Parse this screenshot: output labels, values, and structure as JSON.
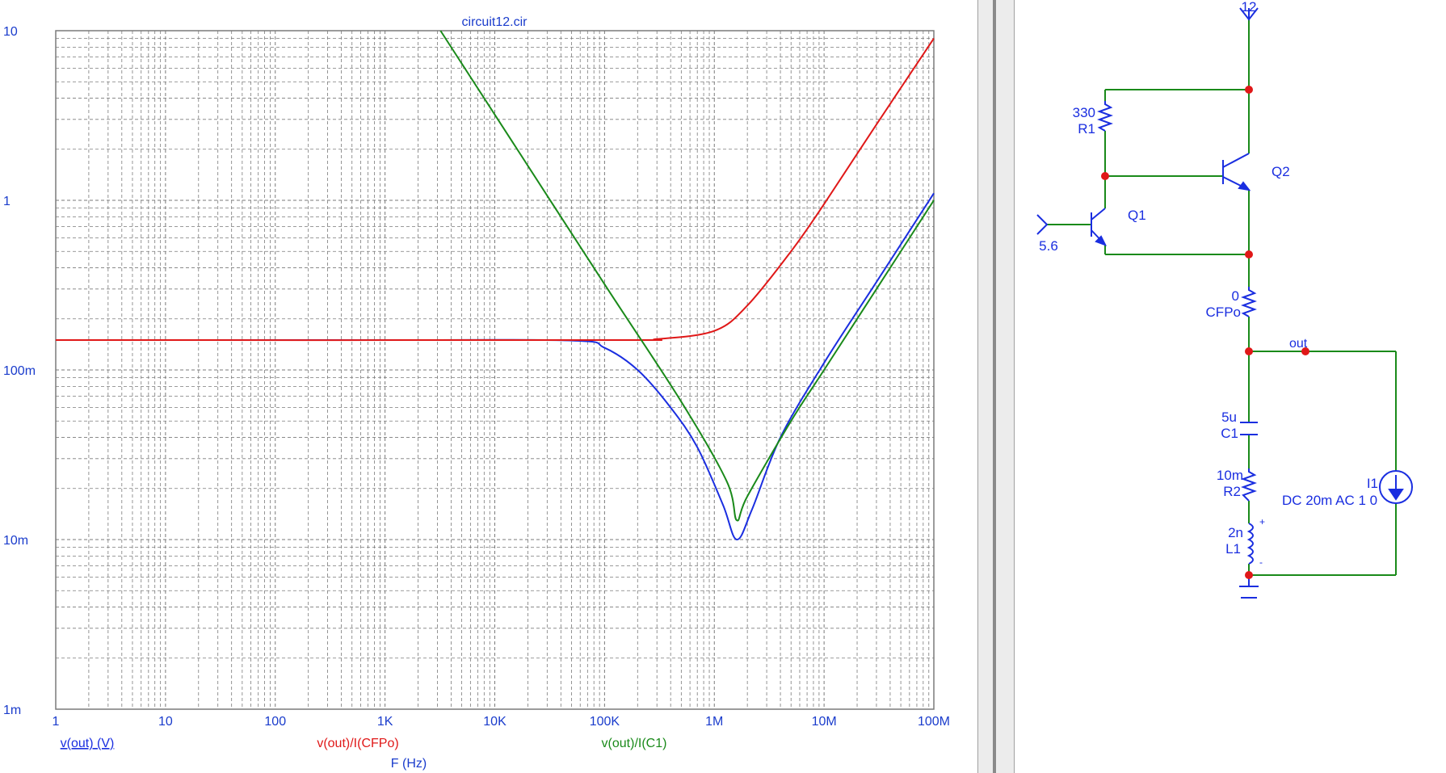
{
  "plot": {
    "title": "circuit12.cir",
    "x_axis_label": "F (Hz)",
    "colors": {
      "grid": "#7a7a7a",
      "axis_text": "#1a3ccc",
      "v_out": "#1a2ee0",
      "v_cfpo": "#e01818",
      "v_c1": "#1a8a1a"
    },
    "traces": [
      {
        "label": "v(out) (V)",
        "color": "#1a2ee0"
      },
      {
        "label": "v(out)/I(CFPo)",
        "color": "#e01818"
      },
      {
        "label": "v(out)/I(C1)",
        "color": "#1a8a1a"
      }
    ]
  },
  "chart_data": {
    "type": "line",
    "title": "circuit12.cir",
    "xlabel": "F (Hz)",
    "ylabel": "",
    "x_scale": "log",
    "y_scale": "log",
    "xlim": [
      1,
      100000000
    ],
    "ylim": [
      0.001,
      10
    ],
    "x_ticks": [
      "1",
      "10",
      "100",
      "1K",
      "10K",
      "100K",
      "1M",
      "10M",
      "100M"
    ],
    "y_ticks": [
      "10",
      "1",
      "100m",
      "10m",
      "1m"
    ],
    "grid": true,
    "series": [
      {
        "name": "v(out) (V)",
        "color": "#1a2ee0",
        "x": [
          1,
          1000,
          50000,
          100000,
          200000,
          400000,
          700000,
          1200000,
          1600000,
          2200000,
          4000000,
          10000000,
          30000000,
          100000000
        ],
        "y": [
          0.15,
          0.15,
          0.149,
          0.135,
          0.1,
          0.06,
          0.035,
          0.016,
          0.01,
          0.015,
          0.04,
          0.11,
          0.33,
          1.1
        ]
      },
      {
        "name": "v(out)/I(CFPo)",
        "color": "#e01818",
        "x": [
          1,
          100000,
          300000,
          1000000,
          2000000,
          5000000,
          10000000,
          30000000,
          100000000
        ],
        "y": [
          0.15,
          0.15,
          0.152,
          0.17,
          0.24,
          0.5,
          0.95,
          2.8,
          9.0
        ]
      },
      {
        "name": "v(out)/I(C1)",
        "color": "#1a8a1a",
        "x": [
          3200,
          10000,
          100000,
          500000,
          1300000,
          1600000,
          2000000,
          5000000,
          10000000,
          30000000,
          100000000
        ],
        "y": [
          10,
          3.2,
          0.32,
          0.065,
          0.022,
          0.013,
          0.018,
          0.05,
          0.1,
          0.3,
          1.0
        ]
      }
    ]
  },
  "schematic": {
    "supply_voltage": "12",
    "input_voltage": "5.6",
    "r1": {
      "value": "330",
      "ref": "R1"
    },
    "q1": "Q1",
    "q2": "Q2",
    "cfpo": {
      "value": "0",
      "ref": "CFPo"
    },
    "out_label": "out",
    "c1": {
      "value": "5u",
      "ref": "C1"
    },
    "r2": {
      "value": "10m",
      "ref": "R2"
    },
    "l1": {
      "value": "2n",
      "ref": "L1"
    },
    "i1": {
      "ref": "I1",
      "value": "DC 20m AC 1 0"
    },
    "colors": {
      "wire": "#1a8a1a",
      "part": "#1a2ee0",
      "node": "#e01818",
      "text": "#1a2ee0"
    }
  }
}
